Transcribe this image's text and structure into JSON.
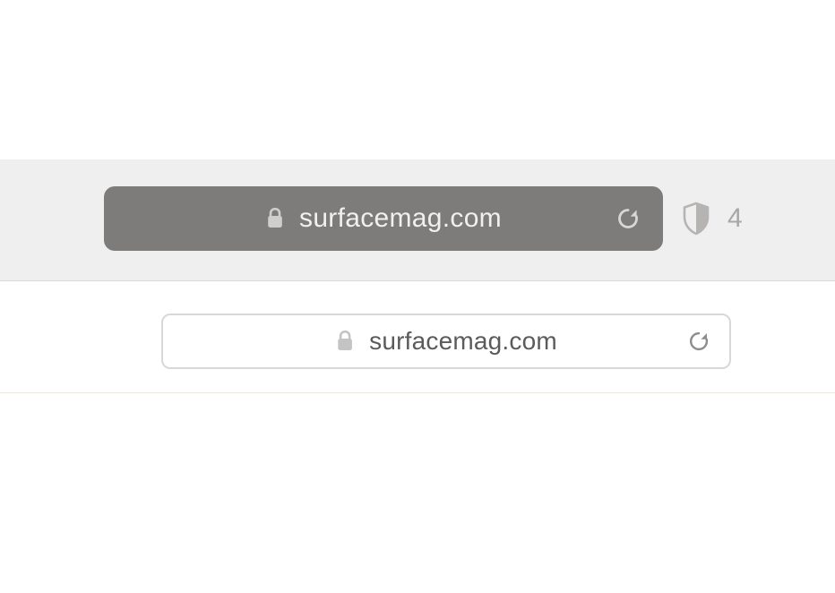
{
  "colors": {
    "dark_bar_bg": "#7e7c7a",
    "dark_bar_fg": "#efeeee",
    "light_bar_border": "#d9d8d7",
    "light_bar_fg": "#5d5b59",
    "chrome_band": "#f0efef",
    "privacy_fg": "#a8a7a6"
  },
  "toolbar_dark": {
    "url": "surfacemag.com",
    "lock_icon": "lock-icon",
    "reload_icon": "reload-icon"
  },
  "privacy": {
    "icon": "shield-icon",
    "count": "4"
  },
  "toolbar_light": {
    "url": "surfacemag.com",
    "lock_icon": "lock-icon",
    "reload_icon": "reload-icon"
  }
}
